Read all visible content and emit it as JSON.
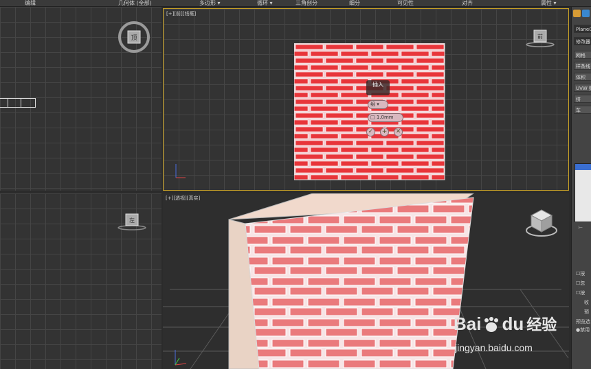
{
  "menubar": {
    "items": [
      {
        "label": "编辑"
      },
      {
        "label": "几何体 (全部)"
      },
      {
        "label": "多边形 ▾"
      },
      {
        "label": "循环 ▾"
      },
      {
        "label": "三角剖分"
      },
      {
        "label": "细分"
      },
      {
        "label": "可见性"
      },
      {
        "label": "对齐"
      },
      {
        "label": "属性 ▾"
      }
    ]
  },
  "viewports": {
    "front_label": "[+][前][线框]",
    "persp_label": "[+][透视][真实]",
    "top_cube_label": "顶",
    "front_cube_label": "前",
    "left_cube_label": "左"
  },
  "caddy": {
    "title": "插入",
    "mode_value": "组",
    "amount_value": "1.0mm",
    "ok_symbol": "✓",
    "apply_symbol": "+",
    "cancel_symbol": "✕"
  },
  "right_panel": {
    "object_name": "Plane0",
    "modifier_list": "修改器",
    "buttons": [
      "网格",
      "样条线",
      "体积",
      "UVW 贴",
      "挤",
      "车"
    ],
    "checkbox_labels": [
      "按",
      "忽",
      "按"
    ],
    "labels": [
      "收",
      "预",
      "预览选",
      "禁用"
    ]
  },
  "watermark": {
    "brand_a": "Bai",
    "brand_b": "du",
    "brand_cn": "经验",
    "url": "jingyan.baidu.com"
  },
  "colors": {
    "brick": "#e8353a",
    "mortar": "#f3cfd2",
    "active_border": "#c9a227"
  }
}
